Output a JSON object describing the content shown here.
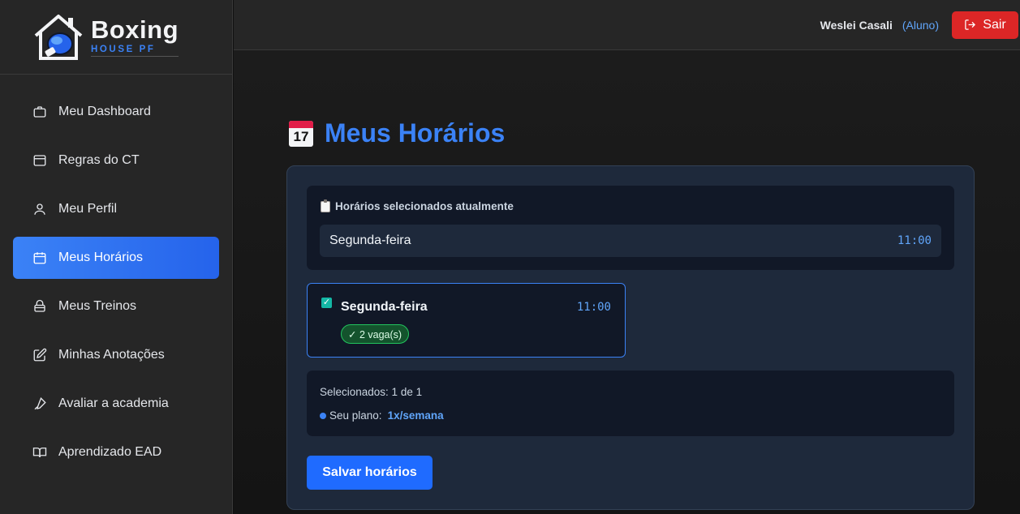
{
  "brand": {
    "name": "Boxing",
    "tagline": "HOUSE PF"
  },
  "sidebar": {
    "items": [
      {
        "label": "Meu Dashboard",
        "icon": "briefcase-icon",
        "active": false
      },
      {
        "label": "Regras do CT",
        "icon": "window-icon",
        "active": false
      },
      {
        "label": "Meu Perfil",
        "icon": "user-icon",
        "active": false
      },
      {
        "label": "Meus Horários",
        "icon": "calendar-icon",
        "active": true
      },
      {
        "label": "Meus Treinos",
        "icon": "bag-icon",
        "active": false
      },
      {
        "label": "Minhas Anotações",
        "icon": "edit-icon",
        "active": false
      },
      {
        "label": "Avaliar a academia",
        "icon": "pen-icon",
        "active": false
      },
      {
        "label": "Aprendizado EAD",
        "icon": "book-icon",
        "active": false
      }
    ]
  },
  "header": {
    "user_name": "Weslei Casali",
    "user_role": "(Aluno)",
    "logout_label": "Sair"
  },
  "main": {
    "title": "Meus Horários",
    "title_emoji_day": "17",
    "current": {
      "label": "Horários selecionados atualmente",
      "day": "Segunda-feira",
      "time": "11:00"
    },
    "slot": {
      "checked": true,
      "check_mark": "✓",
      "day": "Segunda-feira",
      "time": "11:00",
      "badge": "✓ 2 vaga(s)"
    },
    "summary": {
      "selected": "Selecionados: 1 de 1",
      "plan_label": "Seu plano:",
      "plan_value": "1x/semana"
    },
    "save_label": "Salvar horários"
  },
  "colors": {
    "accent": "#3b82f6",
    "danger": "#dc2626",
    "success": "#22c55e"
  }
}
